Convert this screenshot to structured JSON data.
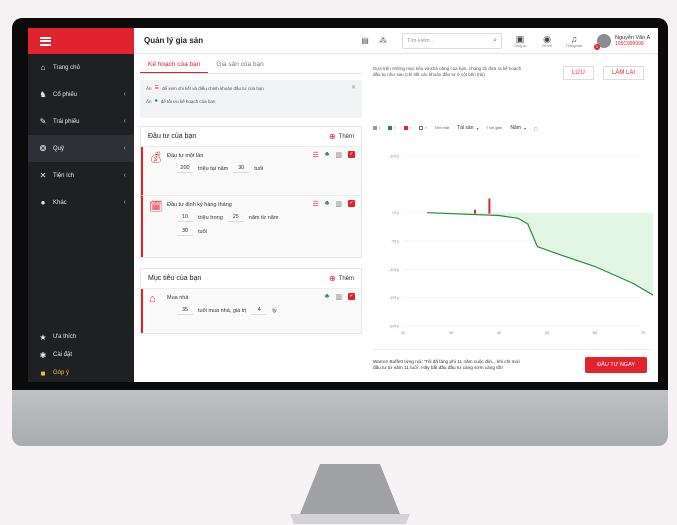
{
  "sidebar": {
    "items": [
      {
        "label": "Trang chủ",
        "icon": "home-icon",
        "glyph": "⌂",
        "chevron": false
      },
      {
        "label": "Cổ phiếu",
        "icon": "bull-icon",
        "glyph": "♞",
        "chevron": true
      },
      {
        "label": "Trái phiếu",
        "icon": "bond-icon",
        "glyph": "✎",
        "chevron": true
      },
      {
        "label": "Quỹ",
        "icon": "fund-icon",
        "glyph": "❂",
        "chevron": true
      },
      {
        "label": "Tiện ích",
        "icon": "tools-icon",
        "glyph": "✕",
        "chevron": true
      },
      {
        "label": "Khác",
        "icon": "more-icon",
        "glyph": "●",
        "chevron": true
      }
    ],
    "bottom": [
      {
        "label": "Ưa thích",
        "glyph": "★"
      },
      {
        "label": "Cài đặt",
        "glyph": "✱"
      },
      {
        "label": "Góp ý",
        "glyph": "■"
      }
    ]
  },
  "topbar": {
    "title": "Quản lý gia sản",
    "search_placeholder": "Tìm kiếm...",
    "buttons": [
      {
        "label": "Công cụ",
        "glyph": "▣"
      },
      {
        "label": "Hỗ trợ",
        "glyph": "◉"
      },
      {
        "label": "Thông báo",
        "glyph": "♫"
      }
    ],
    "user_name": "Nguyễn Văn A",
    "user_id": "105C999999",
    "badge": "0"
  },
  "left": {
    "tabs": [
      "Kế hoạch của bạn",
      "Gia sản của bạn"
    ],
    "note": {
      "row1_prefix": "Ấn",
      "row1_text": "để xem chi tiết và điều chỉnh khoản đầu tư của bạn",
      "row2_prefix": "Ấn",
      "row2_text": "để tối ưu kế hoạch của bạn"
    },
    "invest": {
      "title": "Đầu tư của bạn",
      "add_label": "Thêm",
      "items": [
        {
          "title": "Đầu tư một lần",
          "v1": "200",
          "t1": "triệu tại năm",
          "v2": "30",
          "t2": "tuổi"
        },
        {
          "title": "Đầu tư định kỳ hàng tháng",
          "v1": "10",
          "t1": "triệu trong",
          "v2": "25",
          "t2": "năm từ năm",
          "v3": "30",
          "t3": "tuổi"
        }
      ]
    },
    "goals": {
      "title": "Mục tiêu của bạn",
      "add_label": "Thêm",
      "items": [
        {
          "title": "Mua nhà",
          "v1": "35",
          "t1": "tuổi mua nhà, giá trị",
          "v2": "4",
          "t2": "tỷ"
        }
      ]
    }
  },
  "right": {
    "description": "Dựa trên những mục tiêu và khả năng của bạn, chúng tôi đưa ra kế hoạch đầu tư như sau (chi tiết các khoản đầu tư ở cột bên trái)",
    "save_label": "LƯU",
    "reset_label": "LÀM LẠI",
    "filter_select1": "Tài sản",
    "filter_select2": "Năm",
    "filter_label1": "Tiền mặt",
    "filter_label2": "Thời gian",
    "promo_text": "Warren Buffett từng nói: 'Tôi đã lãng phí 11 năm cuộc đời... khi chỉ mới đầu tư từ năm 11 tuổi'. Hãy bắt đầu đầu tư càng sớm càng tốt!",
    "promo_button": "ĐẦU TƯ NGAY",
    "colors": {
      "accent": "#e1232f",
      "green": "#2c8a3f",
      "area": "#e3f6e5"
    }
  },
  "chart_data": {
    "type": "line",
    "x_ticks": [
      "20",
      "30",
      "40",
      "50",
      "60",
      "70"
    ],
    "y_ticks": [
      "10Tỷ",
      "0Tỷ",
      "-5Tỷ",
      "-10Tỷ",
      "-15Tỷ",
      "-20Tỷ"
    ],
    "series": [
      {
        "values_x": [
          25,
          40,
          44,
          46,
          48,
          53,
          60,
          68,
          73
        ],
        "values_y": [
          0,
          -0.5,
          -1,
          -2,
          -6,
          -7.5,
          -9.5,
          -12.5,
          -15
        ]
      }
    ],
    "markers": [
      {
        "x": 35,
        "y": 0.5
      },
      {
        "x": 38,
        "y": 2.5
      }
    ]
  }
}
